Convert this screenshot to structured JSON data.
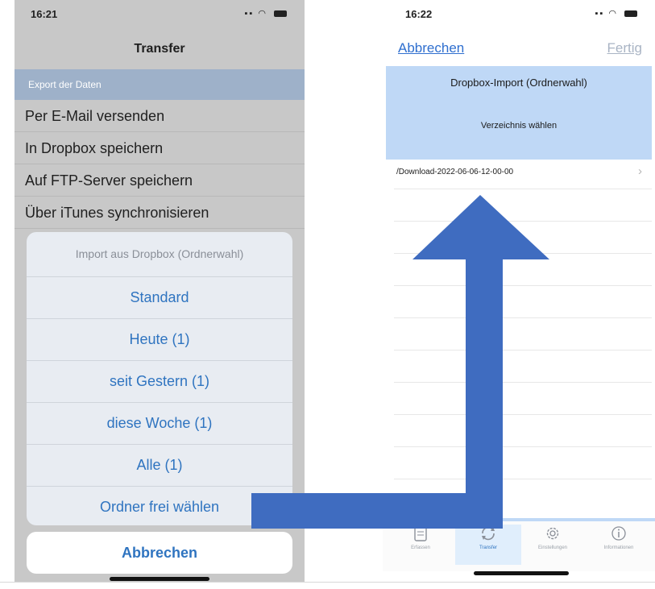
{
  "left_phone": {
    "status_time": "16:21",
    "nav_title": "Transfer",
    "section_header": "Export der Daten",
    "menu_items": [
      "Per E-Mail versenden",
      "In Dropbox speichern",
      "Auf FTP-Server speichern",
      "Über iTunes synchronisieren"
    ],
    "action_sheet": {
      "title": "Import aus Dropbox (Ordnerwahl)",
      "items": [
        "Standard",
        "Heute (1)",
        "seit Gestern (1)",
        "diese Woche (1)",
        "Alle (1)",
        "Ordner frei wählen"
      ],
      "cancel_label": "Abbrechen"
    }
  },
  "right_phone": {
    "status_time": "16:22",
    "nav": {
      "cancel_label": "Abbrechen",
      "done_label": "Fertig"
    },
    "header": {
      "title": "Dropbox-Import (Ordnerwahl)",
      "subtitle": "Verzeichnis wählen"
    },
    "folders": [
      "/Download-2022-06-06-12-00-00"
    ],
    "tabs": [
      {
        "label": "Erfassen",
        "icon": "document-icon"
      },
      {
        "label": "Transfer",
        "icon": "sync-icon",
        "active": true
      },
      {
        "label": "Einstellungen",
        "icon": "gear-icon"
      },
      {
        "label": "Informationen",
        "icon": "info-icon"
      }
    ]
  },
  "colors": {
    "ios_blue": "#2f74c0",
    "header_blue": "#bfd8f6",
    "arrow_blue": "#3f6cc0",
    "section_header": "#9eb1c9"
  }
}
